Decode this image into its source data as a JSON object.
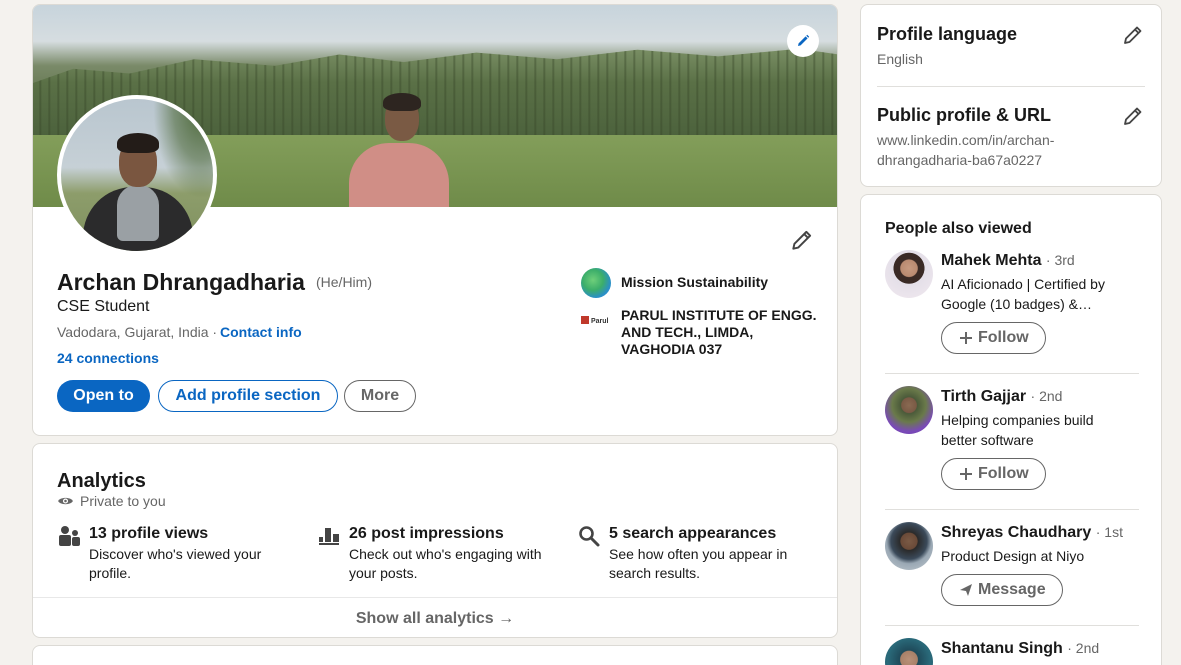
{
  "profile": {
    "name": "Archan Dhrangadharia",
    "pronouns": "(He/Him)",
    "headline": "CSE Student",
    "location": "Vadodara, Gujarat, India · ",
    "contact_info": "Contact info",
    "connections": "24 connections",
    "buttons": {
      "open_to": "Open to",
      "add_section": "Add profile section",
      "more": "More"
    },
    "orgs": [
      {
        "name": "Mission Sustainability",
        "logo": "globe-logo"
      },
      {
        "name": "PARUL INSTITUTE OF ENGG. AND TECH., LIMDA, VAGHODIA 037",
        "logo": "parul-logo",
        "logo_text": "Parul"
      }
    ]
  },
  "analytics": {
    "title": "Analytics",
    "privacy": "Private to you",
    "metrics": [
      {
        "icon": "people-icon",
        "title": "13 profile views",
        "desc": "Discover who's viewed your profile."
      },
      {
        "icon": "bar-chart-icon",
        "title": "26 post impressions",
        "desc": "Check out who's engaging with your posts."
      },
      {
        "icon": "search-icon",
        "title": "5 search appearances",
        "desc": "See how often you appear in search results."
      }
    ],
    "footer": "Show all analytics →"
  },
  "settings": {
    "language_title": "Profile language",
    "language_value": "English",
    "url_title": "Public profile & URL",
    "url_value": "www.linkedin.com/in/archan-dhrangadharia-ba67a0227"
  },
  "people_also_viewed": {
    "title": "People also viewed",
    "people": [
      {
        "name": "Mahek Mehta",
        "degree": "· 3rd",
        "headline": "AI Aficionado | Certified by Google (10 badges) &…",
        "action": "Follow"
      },
      {
        "name": "Tirth Gajjar",
        "degree": "· 2nd",
        "headline": "Helping companies build better software",
        "action": "Follow"
      },
      {
        "name": "Shreyas Chaudhary",
        "degree": "· 1st",
        "headline": "Product Design at Niyo",
        "action": "Message"
      },
      {
        "name": "Shantanu Singh",
        "degree": "· 2nd",
        "headline": "",
        "action": ""
      }
    ]
  },
  "colors": {
    "accent": "#0a66c2",
    "background": "#f4f2ee",
    "muted": "#666666"
  }
}
